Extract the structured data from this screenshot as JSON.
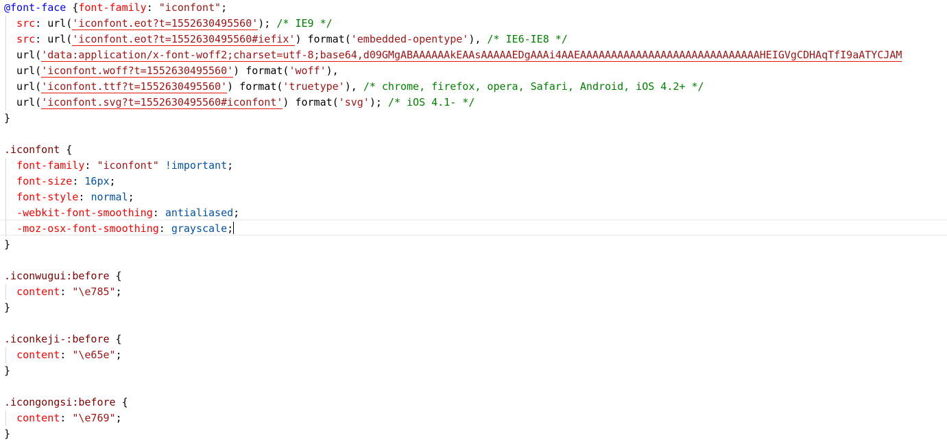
{
  "editor": {
    "lines": [
      [
        {
          "t": "@font-face",
          "c": "at"
        },
        {
          "t": " {",
          "c": "plain"
        },
        {
          "t": "font-family",
          "c": "prop"
        },
        {
          "t": ": ",
          "c": "plain"
        },
        {
          "t": "\"iconfont\"",
          "c": "str"
        },
        {
          "t": ";",
          "c": "plain"
        }
      ],
      [
        {
          "t": "  ",
          "c": "plain"
        },
        {
          "t": "src",
          "c": "prop"
        },
        {
          "t": ": url(",
          "c": "plain"
        },
        {
          "t": "'iconfont.eot?t=1552630495560'",
          "c": "url",
          "e": true
        },
        {
          "t": "); ",
          "c": "plain"
        },
        {
          "t": "/* IE9 */",
          "c": "cmt"
        }
      ],
      [
        {
          "t": "  ",
          "c": "plain"
        },
        {
          "t": "src",
          "c": "prop"
        },
        {
          "t": ": url(",
          "c": "plain"
        },
        {
          "t": "'iconfont.eot?t=1552630495560#iefix'",
          "c": "url",
          "e": true
        },
        {
          "t": ") format(",
          "c": "plain"
        },
        {
          "t": "'embedded-opentype'",
          "c": "str"
        },
        {
          "t": "), ",
          "c": "plain"
        },
        {
          "t": "/* IE6-IE8 */",
          "c": "cmt"
        }
      ],
      [
        {
          "t": "  url(",
          "c": "plain"
        },
        {
          "t": "'data:application/x-font-woff2;charset=utf-8;base64,d09GMgABAAAAAAkEAAsAAAAAEDgAAAi4AAEAAAAAAAAAAAAAAAAAAAAAAAAAAAAAHEIGVgCDHAqTfI9aATYCJAM",
          "c": "url",
          "e": true
        }
      ],
      [
        {
          "t": "  url(",
          "c": "plain"
        },
        {
          "t": "'iconfont.woff?t=1552630495560'",
          "c": "url",
          "e": true
        },
        {
          "t": ") format(",
          "c": "plain"
        },
        {
          "t": "'woff'",
          "c": "str"
        },
        {
          "t": "),",
          "c": "plain"
        }
      ],
      [
        {
          "t": "  url(",
          "c": "plain"
        },
        {
          "t": "'iconfont.ttf?t=1552630495560'",
          "c": "url",
          "e": true
        },
        {
          "t": ") format(",
          "c": "plain"
        },
        {
          "t": "'truetype'",
          "c": "str"
        },
        {
          "t": "), ",
          "c": "plain"
        },
        {
          "t": "/* chrome, firefox, opera, Safari, Android, iOS 4.2+ */",
          "c": "cmt"
        }
      ],
      [
        {
          "t": "  url(",
          "c": "plain"
        },
        {
          "t": "'iconfont.svg?t=1552630495560#iconfont'",
          "c": "url",
          "e": true
        },
        {
          "t": ") format(",
          "c": "plain"
        },
        {
          "t": "'svg'",
          "c": "str"
        },
        {
          "t": "); ",
          "c": "plain"
        },
        {
          "t": "/* iOS 4.1- */",
          "c": "cmt"
        }
      ],
      [
        {
          "t": "}",
          "c": "plain"
        }
      ],
      [],
      [
        {
          "t": ".iconfont",
          "c": "sel"
        },
        {
          "t": " {",
          "c": "plain"
        }
      ],
      [
        {
          "t": "  ",
          "c": "plain"
        },
        {
          "t": "font-family",
          "c": "prop"
        },
        {
          "t": ": ",
          "c": "plain"
        },
        {
          "t": "\"iconfont\"",
          "c": "str"
        },
        {
          "t": " ",
          "c": "plain"
        },
        {
          "t": "!important",
          "c": "val"
        },
        {
          "t": ";",
          "c": "plain"
        }
      ],
      [
        {
          "t": "  ",
          "c": "plain"
        },
        {
          "t": "font-size",
          "c": "prop"
        },
        {
          "t": ": ",
          "c": "plain"
        },
        {
          "t": "16px",
          "c": "val"
        },
        {
          "t": ";",
          "c": "plain"
        }
      ],
      [
        {
          "t": "  ",
          "c": "plain"
        },
        {
          "t": "font-style",
          "c": "prop"
        },
        {
          "t": ": ",
          "c": "plain"
        },
        {
          "t": "normal",
          "c": "val"
        },
        {
          "t": ";",
          "c": "plain"
        }
      ],
      [
        {
          "t": "  ",
          "c": "plain"
        },
        {
          "t": "-webkit-font-smoothing",
          "c": "prop"
        },
        {
          "t": ": ",
          "c": "plain"
        },
        {
          "t": "antialiased",
          "c": "val"
        },
        {
          "t": ";",
          "c": "plain"
        }
      ],
      [
        {
          "t": "  ",
          "c": "plain"
        },
        {
          "t": "-moz-osx-font-smoothing",
          "c": "prop"
        },
        {
          "t": ": ",
          "c": "plain"
        },
        {
          "t": "grayscale",
          "c": "val"
        },
        {
          "t": ";",
          "c": "plain"
        }
      ],
      [
        {
          "t": "}",
          "c": "plain"
        }
      ],
      [],
      [
        {
          "t": ".iconwugui:before",
          "c": "sel"
        },
        {
          "t": " {",
          "c": "plain"
        }
      ],
      [
        {
          "t": "  ",
          "c": "plain"
        },
        {
          "t": "content",
          "c": "prop"
        },
        {
          "t": ": ",
          "c": "plain"
        },
        {
          "t": "\"\\e785\"",
          "c": "str"
        },
        {
          "t": ";",
          "c": "plain"
        }
      ],
      [
        {
          "t": "}",
          "c": "plain"
        }
      ],
      [],
      [
        {
          "t": ".iconkeji-:before",
          "c": "sel"
        },
        {
          "t": " {",
          "c": "plain"
        }
      ],
      [
        {
          "t": "  ",
          "c": "plain"
        },
        {
          "t": "content",
          "c": "prop"
        },
        {
          "t": ": ",
          "c": "plain"
        },
        {
          "t": "\"\\e65e\"",
          "c": "str"
        },
        {
          "t": ";",
          "c": "plain"
        }
      ],
      [
        {
          "t": "}",
          "c": "plain"
        }
      ],
      [],
      [
        {
          "t": ".icongongsi:before",
          "c": "sel"
        },
        {
          "t": " {",
          "c": "plain"
        }
      ],
      [
        {
          "t": "  ",
          "c": "plain"
        },
        {
          "t": "content",
          "c": "prop"
        },
        {
          "t": ": ",
          "c": "plain"
        },
        {
          "t": "\"\\e769\"",
          "c": "str"
        },
        {
          "t": ";",
          "c": "plain"
        }
      ],
      [
        {
          "t": "}",
          "c": "plain"
        }
      ]
    ]
  },
  "colors": {
    "at_rule": "#0000ff",
    "selector": "#800000",
    "property": "#ff0000",
    "value": "#0451a5",
    "string": "#a31515",
    "comment": "#008000",
    "error_underline": "#e51400"
  }
}
